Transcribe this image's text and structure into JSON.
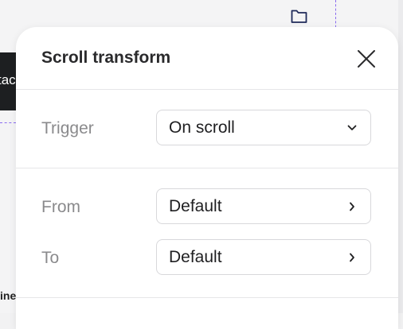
{
  "background": {
    "partial_button_text": "tac",
    "partial_label_text": "ine"
  },
  "panel": {
    "title": "Scroll transform",
    "close_icon": "close-icon"
  },
  "trigger": {
    "label": "Trigger",
    "value": "On scroll",
    "icon": "chevron-down-icon"
  },
  "from": {
    "label": "From",
    "value": "Default",
    "icon": "chevron-right-icon"
  },
  "to": {
    "label": "To",
    "value": "Default",
    "icon": "chevron-right-icon"
  },
  "colors": {
    "guide": "#8a6cf0",
    "dark_block": "#1d1f21",
    "folder_icon": "#1f2a5a"
  }
}
